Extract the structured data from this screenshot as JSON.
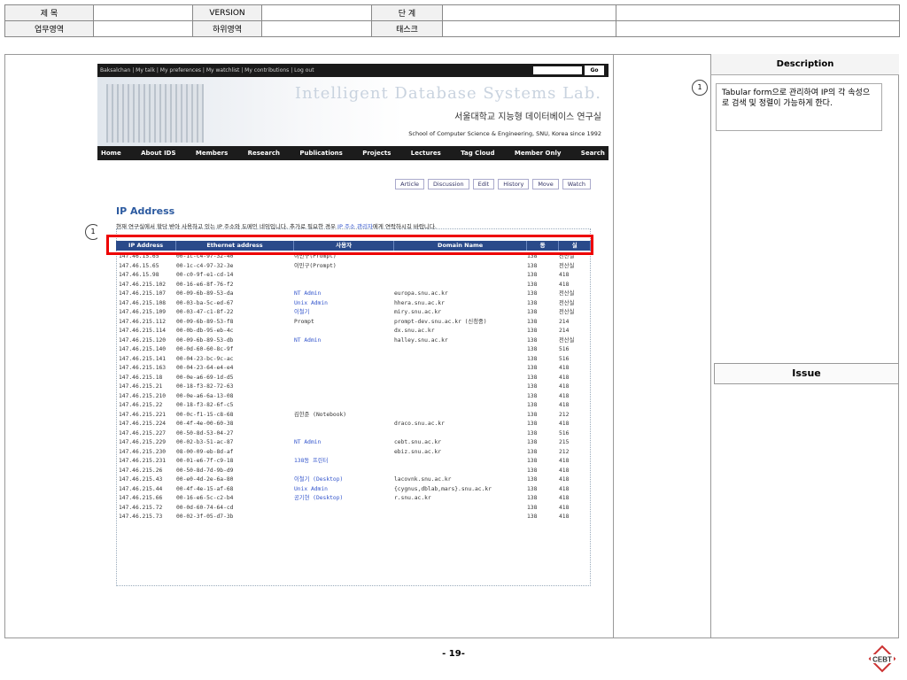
{
  "header": {
    "r1": {
      "l1": "제 목",
      "v1": "",
      "l2": "VERSION",
      "v2": "",
      "l3": "단 계",
      "v3": "",
      "v4": ""
    },
    "r2": {
      "l1": "업무영역",
      "v1": "",
      "l2": "하위영역",
      "v2": "",
      "l3": "태스크",
      "v3": "",
      "v4": ""
    }
  },
  "right_panel": {
    "description_title": "Description",
    "description_marker": "1",
    "description_text": "Tabular form으로 관리하여 IP의 각 속성으로 검색 및 정렬이 가능하게 한다.",
    "issue_title": "Issue"
  },
  "left_marker": "1",
  "site": {
    "topbar": "Baksalchan | My talk | My preferences | My watchlist | My contributions | Log out",
    "go": "Go",
    "banner_title": "Intelligent Database Systems Lab.",
    "banner_korean": "서울대학교 지능형 데이터베이스 연구실",
    "banner_sub": "School of Computer Science & Engineering, SNU, Korea since 1992",
    "nav": [
      "Home",
      "About IDS",
      "Members",
      "Research",
      "Publications",
      "Projects",
      "Lectures",
      "Tag Cloud",
      "Member Only",
      "Search"
    ],
    "tabs": [
      "Article",
      "Discussion",
      "Edit",
      "History",
      "Move",
      "Watch"
    ],
    "title": "IP Address",
    "intro_a": "현재 연구실에서 할당 받아 사용하고 있는 IP 주소와 도메인 네임입니다. 추가로 필요한 경우 ",
    "intro_link": "IP 주소 관리자",
    "intro_b": "에게 연락하시길 바랍니다.",
    "columns": [
      "IP Address",
      "Ethernet address",
      "사용자",
      "Domain Name",
      "동",
      "실"
    ],
    "rows": [
      {
        "ip": "147.46.15.65",
        "mac": "00-1c-c4-97-32-40",
        "user": "이민구(Prompt)",
        "dom": "",
        "b": "138",
        "r": "전산실",
        "ub": false
      },
      {
        "ip": "147.46.15.65",
        "mac": "00-1c-c4-97-32-3e",
        "user": "이민구(Prompt)",
        "dom": "",
        "b": "138",
        "r": "전산실",
        "ub": false
      },
      {
        "ip": "147.46.15.98",
        "mac": "00-c0-9f-e1-cd-14",
        "user": "",
        "dom": "",
        "b": "138",
        "r": "418",
        "ub": false
      },
      {
        "ip": "147.46.215.102",
        "mac": "00-16-e6-8f-76-f2",
        "user": "",
        "dom": "",
        "b": "138",
        "r": "418",
        "ub": false
      },
      {
        "ip": "147.46.215.107",
        "mac": "00-09-6b-89-53-da",
        "user": "NT Admin",
        "dom": "europa.snu.ac.kr",
        "b": "138",
        "r": "전산실",
        "ub": true
      },
      {
        "ip": "147.46.215.108",
        "mac": "00-03-ba-5c-ed-67",
        "user": "Unix Admin",
        "dom": "hhera.snu.ac.kr",
        "b": "138",
        "r": "전산실",
        "ub": true
      },
      {
        "ip": "147.46.215.109",
        "mac": "00-03-47-c1-8f-22",
        "user": "이철기",
        "dom": "miry.snu.ac.kr",
        "b": "138",
        "r": "전산실",
        "ub": true
      },
      {
        "ip": "147.46.215.112",
        "mac": "00-09-6b-89-53-f8",
        "user": "Prompt",
        "dom": "prompt-dev.snu.ac.kr (신청중)",
        "b": "138",
        "r": "214",
        "ub": false
      },
      {
        "ip": "147.46.215.114",
        "mac": "00-0b-db-95-eb-4c",
        "user": "",
        "dom": "dx.snu.ac.kr",
        "b": "138",
        "r": "214",
        "ub": false
      },
      {
        "ip": "147.46.215.120",
        "mac": "00-09-6b-89-53-db",
        "user": "NT Admin",
        "dom": "halley.snu.ac.kr",
        "b": "138",
        "r": "전산실",
        "ub": true
      },
      {
        "ip": "147.46.215.140",
        "mac": "00-0d-60-60-8c-9f",
        "user": "",
        "dom": "",
        "b": "138",
        "r": "516",
        "ub": false
      },
      {
        "ip": "147.46.215.141",
        "mac": "00-04-23-bc-9c-ac",
        "user": "",
        "dom": "",
        "b": "138",
        "r": "516",
        "ub": false
      },
      {
        "ip": "147.46.215.163",
        "mac": "00-04-23-64-e4-e4",
        "user": "",
        "dom": "",
        "b": "138",
        "r": "418",
        "ub": false
      },
      {
        "ip": "147.46.215.18",
        "mac": "00-0e-a6-69-1d-d5",
        "user": "",
        "dom": "",
        "b": "138",
        "r": "418",
        "ub": false
      },
      {
        "ip": "147.46.215.21",
        "mac": "00-18-f3-82-72-63",
        "user": "",
        "dom": "",
        "b": "138",
        "r": "418",
        "ub": false
      },
      {
        "ip": "147.46.215.210",
        "mac": "00-0e-a6-6a-13-08",
        "user": "",
        "dom": "",
        "b": "138",
        "r": "418",
        "ub": false
      },
      {
        "ip": "147.46.215.22",
        "mac": "00-18-f3-82-6f-c5",
        "user": "",
        "dom": "",
        "b": "138",
        "r": "418",
        "ub": false
      },
      {
        "ip": "147.46.215.221",
        "mac": "00-0c-f1-15-c8-68",
        "user": "김한준 (Notebook)",
        "dom": "",
        "b": "138",
        "r": "212",
        "ub": false
      },
      {
        "ip": "147.46.215.224",
        "mac": "00-4f-4e-00-60-38",
        "user": "",
        "dom": "draco.snu.ac.kr",
        "b": "138",
        "r": "418",
        "ub": false
      },
      {
        "ip": "147.46.215.227",
        "mac": "00-50-8d-53-04-27",
        "user": "",
        "dom": "",
        "b": "138",
        "r": "516",
        "ub": false
      },
      {
        "ip": "147.46.215.229",
        "mac": "00-02-b3-51-ac-87",
        "user": "NT Admin",
        "dom": "cebt.snu.ac.kr",
        "b": "138",
        "r": "215",
        "ub": true
      },
      {
        "ip": "147.46.215.230",
        "mac": "08-00-09-eb-8d-af",
        "user": "",
        "dom": "ebiz.snu.ac.kr",
        "b": "138",
        "r": "212",
        "ub": false
      },
      {
        "ip": "147.46.215.231",
        "mac": "00-01-e6-7f-c9-18",
        "user": "138동 프린터",
        "dom": "",
        "b": "138",
        "r": "418",
        "ub": true
      },
      {
        "ip": "147.46.215.26",
        "mac": "00-50-8d-7d-9b-d9",
        "user": "",
        "dom": "",
        "b": "138",
        "r": "418",
        "ub": false
      },
      {
        "ip": "147.46.215.43",
        "mac": "00-e0-4d-2e-6a-80",
        "user": "이철기 (Desktop)",
        "dom": "lacovnk.snu.ac.kr",
        "b": "138",
        "r": "418",
        "ub": true
      },
      {
        "ip": "147.46.215.44",
        "mac": "00-4f-4e-15-af-68",
        "user": "Unix Admin",
        "dom": "{cygnus,dblab,mars}.snu.ac.kr",
        "b": "138",
        "r": "418",
        "ub": true
      },
      {
        "ip": "147.46.215.66",
        "mac": "00-16-e6-5c-c2-b4",
        "user": "공기현 (Desktop)",
        "dom": "r.snu.ac.kr",
        "b": "138",
        "r": "418",
        "ub": true
      },
      {
        "ip": "147.46.215.72",
        "mac": "00-0d-60-74-64-cd",
        "user": "",
        "dom": "",
        "b": "138",
        "r": "418",
        "ub": false
      },
      {
        "ip": "147.46.215.73",
        "mac": "00-02-3f-05-d7-3b",
        "user": "",
        "dom": "",
        "b": "138",
        "r": "418",
        "ub": false
      }
    ]
  },
  "page_number": "- 19-",
  "logo_text": "CEBT"
}
